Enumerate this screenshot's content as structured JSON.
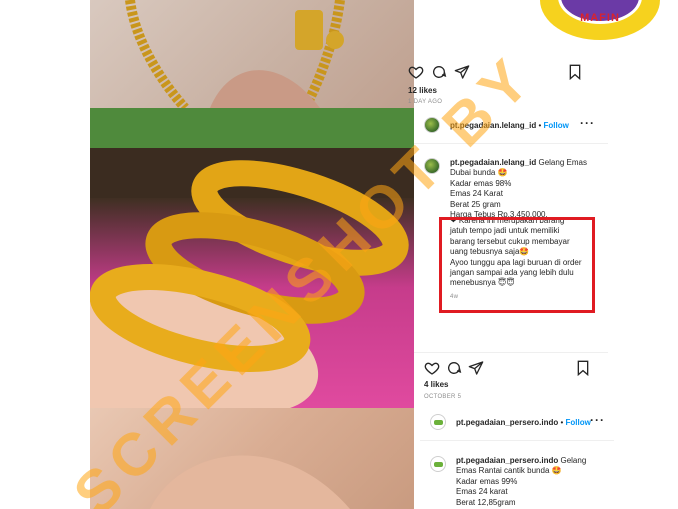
{
  "badge": {
    "label": "MAFIN"
  },
  "post1": {
    "likes": "12 likes",
    "time": "1 DAY AGO"
  },
  "post2": {
    "username": "pt.pegadaian.lelang_id",
    "separator": "•",
    "follow": "Follow",
    "more": "···",
    "caption_user": "pt.pegadaian.lelang_id",
    "caption_lines": "Gelang Emas\nDubai bunda 🤩\nKadar emas 98%\nEmas 24 Karat\nBerat 25 gram\nHarga Tebus Rp.3.450.000.",
    "highlight_lines": "❤ Karena ini merupakan barang\njatuh tempo jadi untuk memiliki\nbarang tersebut cukup membayar\nuang tebusnya saja🤩\nAyoo tunggu apa lagi buruan di order\njangan sampai ada yang lebih dulu\nmenebusnya 😇😇",
    "comment_time": "4w",
    "likes": "4 likes",
    "date": "OCTOBER 5"
  },
  "post3": {
    "username": "pt.pegadaian_persero.indo",
    "separator": "•",
    "follow": "Follow",
    "more": "···",
    "caption_user": "pt.pegadaian_persero.indo",
    "caption_lines": "Gelang\nEmas Rantai cantik bunda 🤩\nKadar emas 99%\nEmas 24 karat\nBerat 12,85gram"
  },
  "watermark": "SCREENSHOT BY",
  "colors": {
    "accent_red": "#e01b22",
    "link_blue": "#0095f6",
    "watermark_orange": "#ffa614"
  },
  "icons": [
    "heart-icon",
    "comment-icon",
    "share-icon",
    "bookmark-icon"
  ]
}
